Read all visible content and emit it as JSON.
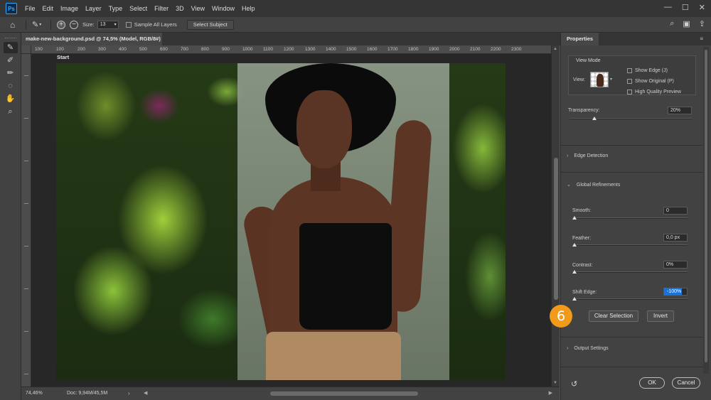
{
  "app": {
    "logo": "Ps"
  },
  "menu": [
    "File",
    "Edit",
    "Image",
    "Layer",
    "Type",
    "Select",
    "Filter",
    "3D",
    "View",
    "Window",
    "Help"
  ],
  "window_controls": {
    "minimize": "—",
    "maximize": "☐",
    "close": "✕"
  },
  "options": {
    "size_label": "Size:",
    "size_value": "13",
    "sample_all_layers": "Sample All Layers",
    "select_subject": "Select Subject"
  },
  "document": {
    "tab_title": "make-new-background.psd @ 74,5% (Model, RGB/8#)",
    "close": "×",
    "start_label": "Start",
    "ruler_ticks": [
      "100",
      "100",
      "200",
      "300",
      "400",
      "500",
      "600",
      "700",
      "800",
      "900",
      "1000",
      "1100",
      "1200",
      "1300",
      "1400",
      "1500",
      "1600",
      "1700",
      "1800",
      "1900",
      "2000",
      "2100",
      "2200",
      "2300"
    ]
  },
  "status": {
    "zoom": "74,46%",
    "doc": "Doc: 9,94M/45,5M",
    "arrow": "›"
  },
  "properties": {
    "tab": "Properties",
    "view_mode": {
      "title": "View Mode",
      "view_label": "View:",
      "show_edge": "Show Edge (J)",
      "show_original": "Show Original (P)",
      "high_quality": "High Quality Preview"
    },
    "transparency": {
      "label": "Transparency:",
      "value": "20%",
      "level": 0.2
    },
    "edge_detection": "Edge Detection",
    "global_refinements": "Global Refinements",
    "smooth": {
      "label": "Smooth:",
      "value": "0"
    },
    "feather": {
      "label": "Feather:",
      "value": "0,0 px"
    },
    "contrast": {
      "label": "Contrast:",
      "value": "0%"
    },
    "shift_edge": {
      "label": "Shift Edge:",
      "value": "-100%"
    },
    "clear_selection": "Clear Selection",
    "invert": "Invert",
    "output_settings": "Output Settings",
    "ok": "OK",
    "cancel": "Cancel"
  },
  "callout": "6",
  "colors": {
    "accent": "#f29a1a",
    "highlight": "#1a73d4",
    "brand": "#31a8ff"
  }
}
